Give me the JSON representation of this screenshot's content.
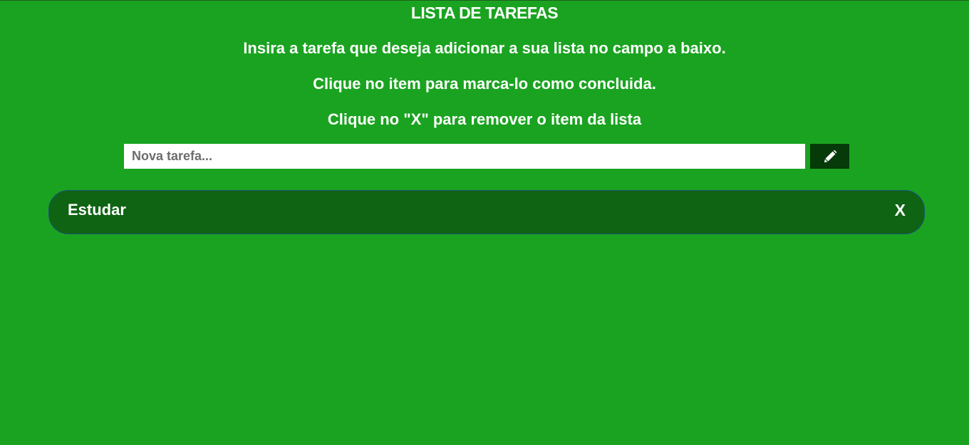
{
  "header": {
    "title": "LISTA DE TAREFAS",
    "instructions": [
      "Insira a tarefa que deseja adicionar a sua lista no campo a baixo.",
      "Clique no item para marca-lo como concluida.",
      "Clique no \"X\" para remover o item da lista"
    ]
  },
  "form": {
    "placeholder": "Nova tarefa...",
    "value": "",
    "submit_icon": "pencil-icon"
  },
  "tasks": [
    {
      "label": "Estudar",
      "remove_label": "X"
    }
  ],
  "colors": {
    "background": "#1aa320",
    "button": "#063a09",
    "task_item": "#0f6414",
    "task_border": "#1b4f7a",
    "text": "#ffffff"
  }
}
